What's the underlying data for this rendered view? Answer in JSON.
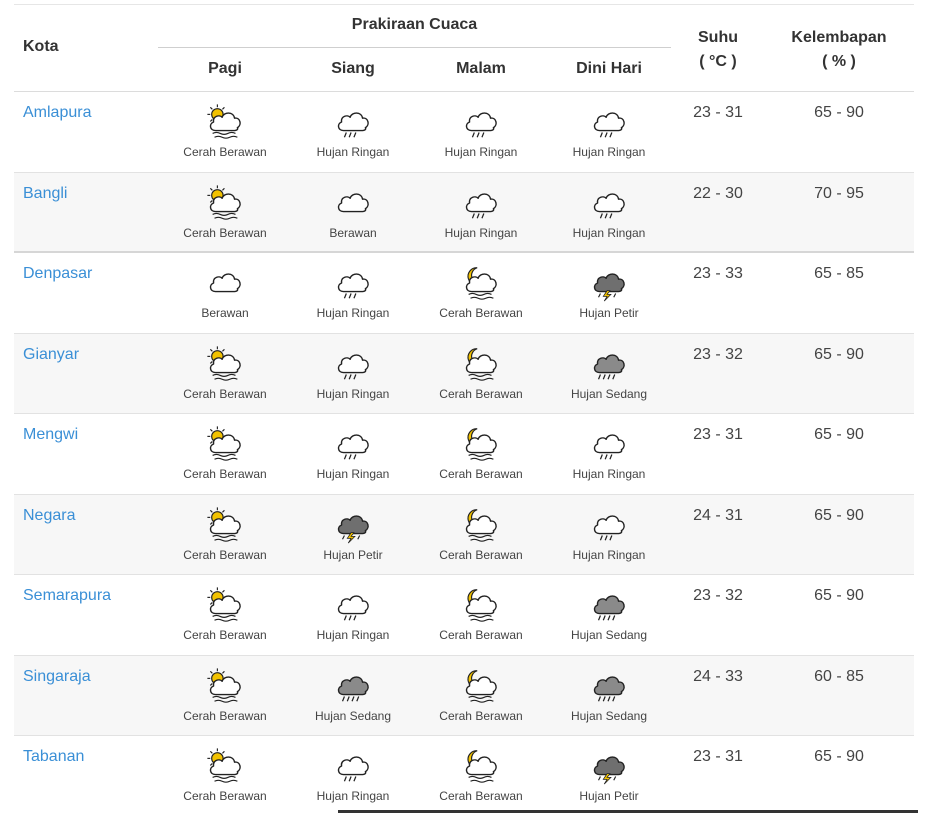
{
  "table": {
    "headers": {
      "kota": "Kota",
      "prakiraan": "Prakiraan Cuaca",
      "pagi": "Pagi",
      "siang": "Siang",
      "malam": "Malam",
      "dini_hari": "Dini Hari",
      "suhu": "Suhu",
      "suhu_unit": "( °C )",
      "kelembapan": "Kelembapan",
      "kelembapan_unit": "( % )"
    },
    "rows": [
      {
        "city": "Amlapura",
        "forecast": [
          {
            "icon": "partly-cloudy-day-icon",
            "label": "Cerah Berawan"
          },
          {
            "icon": "light-rain-icon",
            "label": "Hujan Ringan"
          },
          {
            "icon": "light-rain-icon",
            "label": "Hujan Ringan"
          },
          {
            "icon": "light-rain-icon",
            "label": "Hujan Ringan"
          }
        ],
        "suhu": "23 - 31",
        "kelembapan": "65 - 90"
      },
      {
        "city": "Bangli",
        "forecast": [
          {
            "icon": "partly-cloudy-day-icon",
            "label": "Cerah Berawan"
          },
          {
            "icon": "cloudy-icon",
            "label": "Berawan"
          },
          {
            "icon": "light-rain-icon",
            "label": "Hujan Ringan"
          },
          {
            "icon": "light-rain-icon",
            "label": "Hujan Ringan"
          }
        ],
        "suhu": "22 - 30",
        "kelembapan": "70 - 95"
      },
      {
        "city": "Denpasar",
        "forecast": [
          {
            "icon": "cloudy-icon",
            "label": "Berawan"
          },
          {
            "icon": "light-rain-icon",
            "label": "Hujan Ringan"
          },
          {
            "icon": "partly-cloudy-night-icon",
            "label": "Cerah Berawan"
          },
          {
            "icon": "thunderstorm-icon",
            "label": "Hujan Petir"
          }
        ],
        "suhu": "23 - 33",
        "kelembapan": "65 - 85"
      },
      {
        "city": "Gianyar",
        "forecast": [
          {
            "icon": "partly-cloudy-day-icon",
            "label": "Cerah Berawan"
          },
          {
            "icon": "light-rain-icon",
            "label": "Hujan Ringan"
          },
          {
            "icon": "partly-cloudy-night-icon",
            "label": "Cerah Berawan"
          },
          {
            "icon": "moderate-rain-icon",
            "label": "Hujan Sedang"
          }
        ],
        "suhu": "23 - 32",
        "kelembapan": "65 - 90"
      },
      {
        "city": "Mengwi",
        "forecast": [
          {
            "icon": "partly-cloudy-day-icon",
            "label": "Cerah Berawan"
          },
          {
            "icon": "light-rain-icon",
            "label": "Hujan Ringan"
          },
          {
            "icon": "partly-cloudy-night-icon",
            "label": "Cerah Berawan"
          },
          {
            "icon": "light-rain-icon",
            "label": "Hujan Ringan"
          }
        ],
        "suhu": "23 - 31",
        "kelembapan": "65 - 90"
      },
      {
        "city": "Negara",
        "forecast": [
          {
            "icon": "partly-cloudy-day-icon",
            "label": "Cerah Berawan"
          },
          {
            "icon": "thunderstorm-icon",
            "label": "Hujan Petir"
          },
          {
            "icon": "partly-cloudy-night-icon",
            "label": "Cerah Berawan"
          },
          {
            "icon": "light-rain-icon",
            "label": "Hujan Ringan"
          }
        ],
        "suhu": "24 - 31",
        "kelembapan": "65 - 90"
      },
      {
        "city": "Semarapura",
        "forecast": [
          {
            "icon": "partly-cloudy-day-icon",
            "label": "Cerah Berawan"
          },
          {
            "icon": "light-rain-icon",
            "label": "Hujan Ringan"
          },
          {
            "icon": "partly-cloudy-night-icon",
            "label": "Cerah Berawan"
          },
          {
            "icon": "moderate-rain-icon",
            "label": "Hujan Sedang"
          }
        ],
        "suhu": "23 - 32",
        "kelembapan": "65 - 90"
      },
      {
        "city": "Singaraja",
        "forecast": [
          {
            "icon": "partly-cloudy-day-icon",
            "label": "Cerah Berawan"
          },
          {
            "icon": "moderate-rain-icon",
            "label": "Hujan Sedang"
          },
          {
            "icon": "partly-cloudy-night-icon",
            "label": "Cerah Berawan"
          },
          {
            "icon": "moderate-rain-icon",
            "label": "Hujan Sedang"
          }
        ],
        "suhu": "24 - 33",
        "kelembapan": "60 - 85"
      },
      {
        "city": "Tabanan",
        "forecast": [
          {
            "icon": "partly-cloudy-day-icon",
            "label": "Cerah Berawan"
          },
          {
            "icon": "light-rain-icon",
            "label": "Hujan Ringan"
          },
          {
            "icon": "partly-cloudy-night-icon",
            "label": "Cerah Berawan"
          },
          {
            "icon": "thunderstorm-icon",
            "label": "Hujan Petir"
          }
        ],
        "suhu": "23 - 31",
        "kelembapan": "65 - 90"
      }
    ]
  },
  "colors": {
    "link": "#3a8fd6",
    "sun": "#f2c200",
    "cloud_dark": "#8a8a8a",
    "row_alt": "#f7f7f7"
  }
}
